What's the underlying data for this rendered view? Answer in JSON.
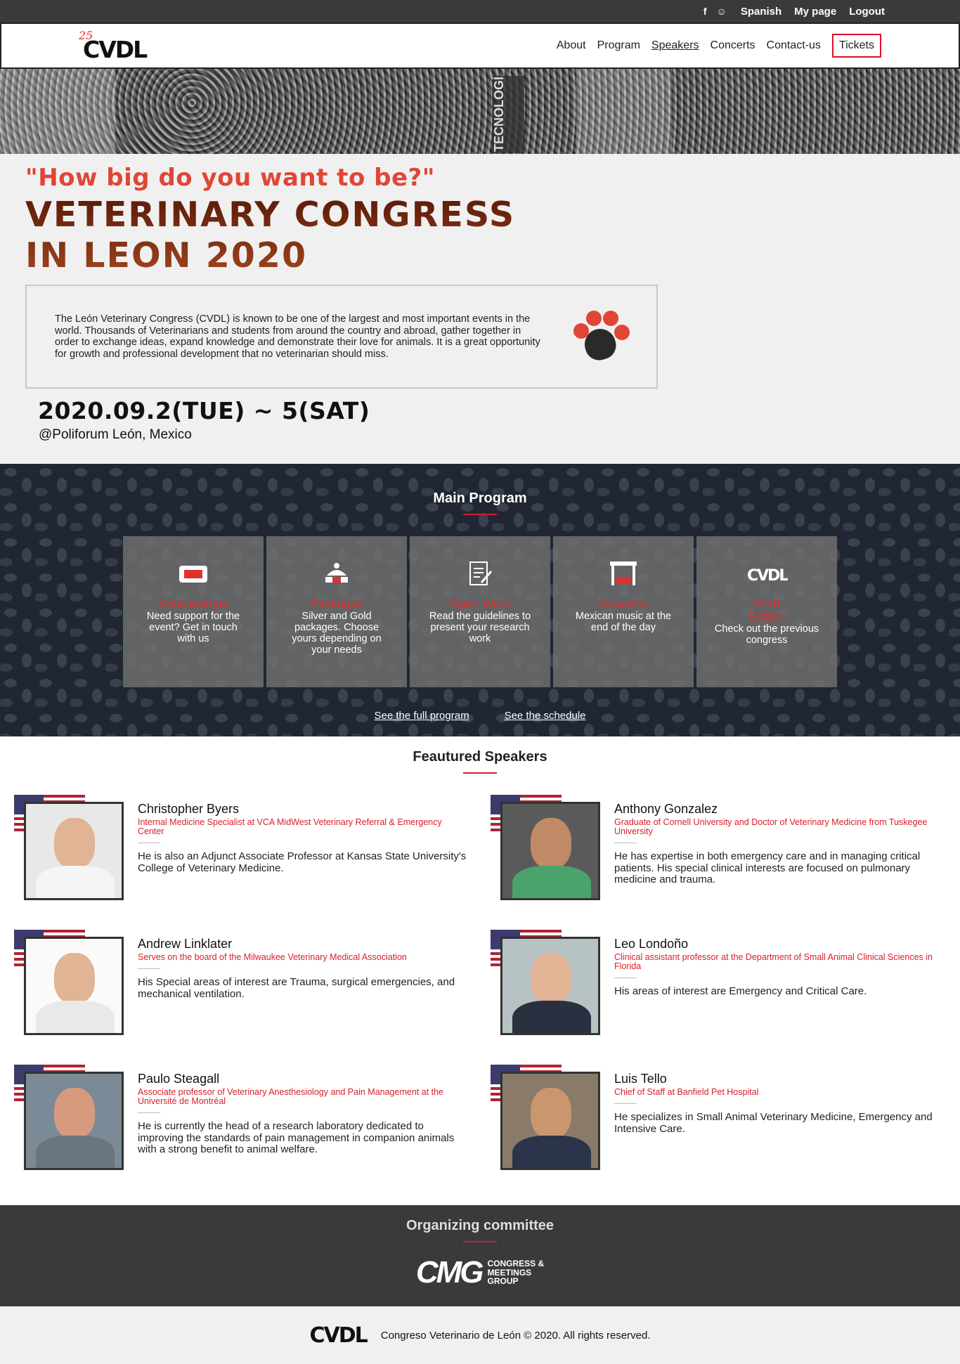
{
  "topbar": {
    "language": "Spanish",
    "my_page": "My page",
    "logout": "Logout",
    "icons": [
      "facebook-icon",
      "user-icon"
    ]
  },
  "brand": {
    "year_mark": "25",
    "logo_text": "CVDL"
  },
  "nav": {
    "about": "About",
    "program": "Program",
    "speakers": "Speakers",
    "concerts": "Concerts",
    "contact": "Contact-us",
    "tickets": "Tickets"
  },
  "hero": {
    "sign_text": "TECNOLOGÍ",
    "quote": "\"How big do you want to be?\"",
    "title_line1": "VETERINARY CONGRESS",
    "title_line2": "IN LEON 2020",
    "about": "The León Veterinary Congress (CVDL) is known to be one of the largest and most important events in the world. Thousands of Veterinarians and students from around the country and abroad, gather together in order to exchange ideas, expand knowledge and demonstrate their love for animals. It is a great opportunity for growth and professional development that no veterinarian should miss.",
    "date": "2020.09.2(TUE) ~ 5(SAT)",
    "venue": "@Poliforum León, Mexico"
  },
  "program": {
    "heading": "Main Program",
    "cards": [
      {
        "title": "Scholarships",
        "text": "Need support for the event? Get in touch with us",
        "icon": "ticket-icon"
      },
      {
        "title": "Packages",
        "text": "Silver and Gold packages. Choose yours depending on your needs",
        "icon": "package-icon"
      },
      {
        "title": "Open Work",
        "text": "Read the guidelines to present your research work",
        "icon": "document-edit-icon"
      },
      {
        "title": "Concerts",
        "text": "Mexican music at the end of the day",
        "icon": "stage-icon"
      },
      {
        "title": "2019 Edition",
        "text": "Check out the previous congress",
        "icon": "cvdl-logo-icon"
      }
    ],
    "full_program": "See the full program",
    "schedule": "See the schedule"
  },
  "speakers": {
    "heading": "Feautured Speakers",
    "list": [
      {
        "name": "Christopher Byers",
        "role": "Internal Medicine Specialist at VCA MidWest Veterinary Referral & Emergency Center",
        "bio": "He is also an Adjunct Associate Professor at Kansas State University's College of Veterinary Medicine."
      },
      {
        "name": "Anthony Gonzalez",
        "role": "Graduate of Cornell University and Doctor of Veterinary Medicine from Tuskegee University",
        "bio": "He has expertise in both emergency care and in managing critical patients. His special clinical interests are focused on pulmonary medicine and trauma."
      },
      {
        "name": "Andrew Linklater",
        "role": "Serves on the board of the Milwaukee Veterinary Medical Association",
        "bio": "His Special areas of interest are Trauma, surgical emergencies, and mechanical ventilation."
      },
      {
        "name": "Leo Londoño",
        "role": "Clinical assistant professor at the Department of Small Animal Clinical Sciences in Florida",
        "bio": "His areas of interest are Emergency and Critical Care."
      },
      {
        "name": "Paulo Steagall",
        "role": "Associate professor of Veterinary Anesthesiology and Pain Management at the Université de Montréal",
        "bio": "He is currently the head of a research laboratory dedicated to improving the standards of pain management in companion animals with a strong benefit to animal welfare."
      },
      {
        "name": "Luis Tello",
        "role": "Chief of Staff at Banfield Pet Hospital",
        "bio": "He specializes in Small Animal Veterinary Medicine, Emergency and Intensive Care."
      }
    ]
  },
  "committee": {
    "heading": "Organizing committee",
    "logo_big": "CMG",
    "logo_small": [
      "CONGRESS &",
      "MEETINGS",
      "GROUP"
    ]
  },
  "footer": {
    "logo": "CVDL",
    "copyright": "Congreso Veterinario de León © 2020. All rights reserved."
  },
  "colors": {
    "accent_red": "#e04636",
    "link_red": "#d8202a",
    "dark_bg": "#202733",
    "topbar_bg": "#3a3a3a"
  }
}
